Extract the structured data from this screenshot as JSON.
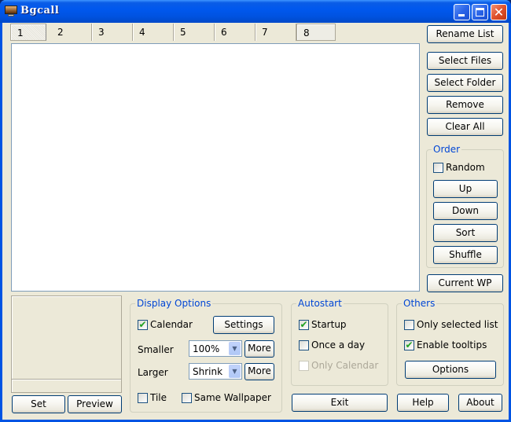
{
  "window": {
    "title": "Bgcall",
    "icon": "monitor-icon",
    "controls": {
      "minimize": "minimize-icon",
      "maximize": "maximize-icon",
      "close": "close-icon",
      "close_glyph": "✕"
    }
  },
  "tabs": [
    {
      "label": "1",
      "active": true
    },
    {
      "label": "2"
    },
    {
      "label": "3"
    },
    {
      "label": "4"
    },
    {
      "label": "5"
    },
    {
      "label": "6"
    },
    {
      "label": "7"
    },
    {
      "label": "8"
    }
  ],
  "list": {
    "items": []
  },
  "right_panel": {
    "rename_list": "Rename List",
    "select_files": "Select Files",
    "select_folder": "Select Folder",
    "remove": "Remove",
    "clear_all": "Clear All",
    "order": {
      "title": "Order",
      "random": {
        "label": "Random",
        "checked": false
      },
      "up": "Up",
      "down": "Down",
      "sort": "Sort",
      "shuffle": "Shuffle"
    },
    "current_wp": "Current WP"
  },
  "preview": {
    "set": "Set",
    "preview": "Preview"
  },
  "display_options": {
    "title": "Display Options",
    "calendar": {
      "label": "Calendar",
      "checked": true
    },
    "settings": "Settings",
    "smaller": {
      "label": "Smaller",
      "value": "100%",
      "more": "More"
    },
    "larger": {
      "label": "Larger",
      "value": "Shrink",
      "more": "More"
    },
    "tile": {
      "label": "Tile",
      "checked": false
    },
    "same_wallpaper": {
      "label": "Same Wallpaper",
      "checked": false
    }
  },
  "autostart": {
    "title": "Autostart",
    "startup": {
      "label": "Startup",
      "checked": true
    },
    "once_a_day": {
      "label": "Once a day",
      "checked": false
    },
    "only_calendar": {
      "label": "Only Calendar",
      "checked": false,
      "disabled": true
    }
  },
  "others": {
    "title": "Others",
    "only_selected_list": {
      "label": "Only selected list",
      "checked": false
    },
    "enable_tooltips": {
      "label": "Enable tooltips",
      "checked": true
    },
    "options": "Options"
  },
  "footer": {
    "exit": "Exit",
    "help": "Help",
    "about": "About"
  },
  "glyphs": {
    "check": "✔",
    "dropdown": "▼"
  }
}
